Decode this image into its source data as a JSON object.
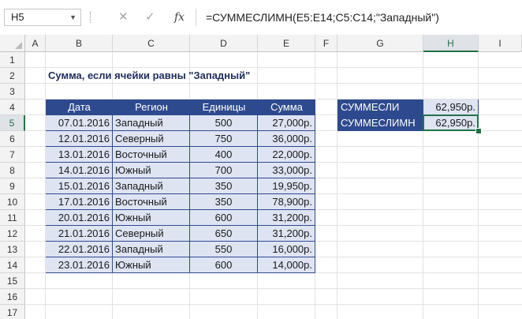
{
  "formula_bar": {
    "name_box": "H5",
    "cancel_icon": "✕",
    "enter_icon": "✓",
    "fx_label": "fx",
    "formula": "=СУММЕСЛИМН(E5:E14;C5:C14;\"Западный\")"
  },
  "columns": [
    "A",
    "B",
    "C",
    "D",
    "E",
    "F",
    "G",
    "H",
    "I"
  ],
  "rows": [
    "1",
    "2",
    "3",
    "4",
    "5",
    "6",
    "7",
    "8",
    "9",
    "10",
    "11",
    "12",
    "13",
    "14",
    "15",
    "16",
    "17"
  ],
  "selected_cell": "H5",
  "sheet": {
    "title": "Сумма, если ячейки равны \"Западный\"",
    "headers": [
      "Дата",
      "Регион",
      "Единицы",
      "Сумма"
    ],
    "rows": [
      [
        "07.01.2016",
        "Западный",
        "500",
        "27,000р."
      ],
      [
        "12.01.2016",
        "Северный",
        "750",
        "36,000р."
      ],
      [
        "13.01.2016",
        "Восточный",
        "400",
        "22,000р."
      ],
      [
        "14.01.2016",
        "Южный",
        "700",
        "33,000р."
      ],
      [
        "15.01.2016",
        "Западный",
        "350",
        "19,950р."
      ],
      [
        "17.01.2016",
        "Восточный",
        "350",
        "78,900р."
      ],
      [
        "20.01.2016",
        "Южный",
        "600",
        "31,200р."
      ],
      [
        "21.01.2016",
        "Северный",
        "650",
        "31,200р."
      ],
      [
        "22.01.2016",
        "Западный",
        "550",
        "16,000р."
      ],
      [
        "23.01.2016",
        "Южный",
        "600",
        "14,000р."
      ]
    ],
    "summary": [
      {
        "label": "СУММЕСЛИ",
        "value": "62,950р."
      },
      {
        "label": "СУММЕСЛИМН",
        "value": "62,950р."
      }
    ]
  },
  "colors": {
    "table_header_bg": "#2e4a8f",
    "table_cell_bg": "#dfe4f3",
    "selection": "#217346"
  }
}
